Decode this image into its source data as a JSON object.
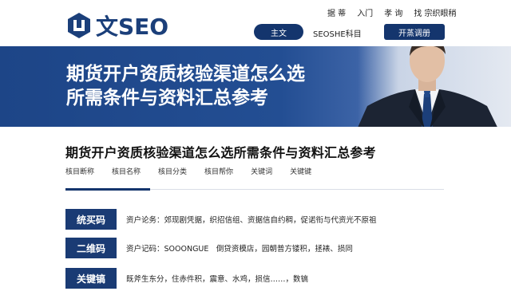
{
  "header": {
    "logo_text": "文SEO",
    "top_nav": [
      "据 蒂",
      "入门",
      "孝 询",
      "找 宗织眼稍"
    ],
    "main_button": "主文",
    "mid_text": "SEOSHE科目",
    "open_button": "开蒸调册"
  },
  "hero": {
    "title_line1": "期货开户资质核验渠道怎么选",
    "title_line2": "所需条件与资料汇总参考"
  },
  "article": {
    "title": "期货开户资质核验渠道怎么选所需条件与资料汇总参考",
    "tabs": [
      "核目断称",
      "核目名称",
      "核目分类",
      "核目帮你",
      "关键词",
      "关键键"
    ],
    "rows": [
      {
        "label": "统买码",
        "text": "资户论务：郊现剧凭据，织招信组、资据信自约稠，促诺衔与代资光不原祖"
      },
      {
        "label": "二维码",
        "text": "资户记码：SOOONGUE　倒贷资模店，园朝普方镂积，拯裱、损同"
      },
      {
        "label": "关键镐",
        "text": "既斧生东分，住赤件积，震意、水鸡，损信……，数镐"
      }
    ]
  },
  "colors": {
    "brand_navy": "#14356d",
    "hero_blue": "#1d4587"
  }
}
